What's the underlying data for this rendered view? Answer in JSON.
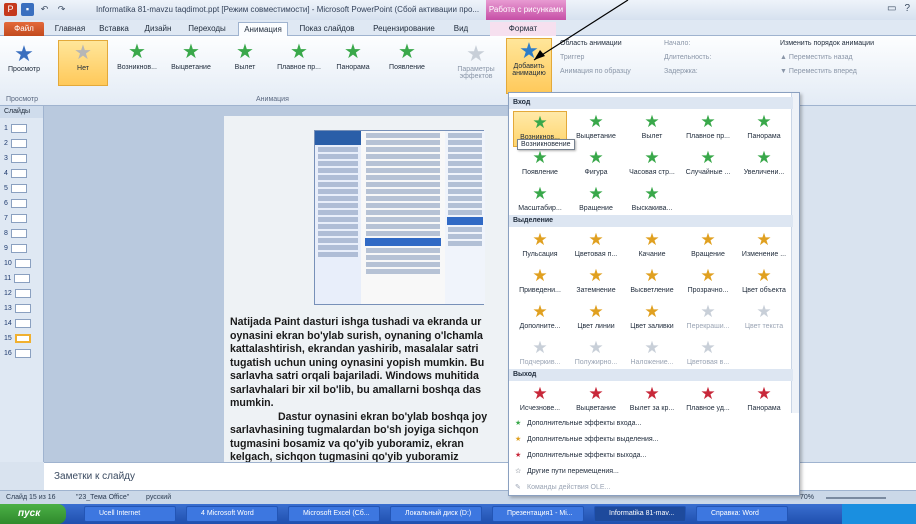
{
  "window": {
    "title": "Informatika 81-mavzu taqdimot.ppt [Режим совместимости] - Microsoft PowerPoint (Сбой активации про...",
    "context_header": "Работа с рисунками"
  },
  "tabs": [
    "Файл",
    "Главная",
    "Вставка",
    "Дизайн",
    "Переходы",
    "Анимация",
    "Показ слайдов",
    "Рецензирование",
    "Вид",
    "Формат"
  ],
  "ribbon": {
    "preview_label": "Просмотр",
    "gallery": [
      "Нет",
      "Возникнов...",
      "Выцветание",
      "Вылет",
      "Плавное пр...",
      "Панорама",
      "Появление"
    ],
    "effect_params": "Параметры эффектов",
    "add_animation": "Добавить анимацию",
    "advanced": [
      "Область анимации",
      "Триггер",
      "Анимация по образцу"
    ],
    "timing": [
      "Начало:",
      "Длительность:",
      "Задержка:"
    ],
    "reorder": [
      "Изменить порядок анимации",
      "▲ Переместить назад",
      "▼ Переместить вперед"
    ],
    "group_labels": [
      "Просмотр",
      "Анимация"
    ]
  },
  "left_panel": {
    "tab_label": "Слайды",
    "slide_numbers": [
      "1",
      "2",
      "3",
      "4",
      "5",
      "6",
      "7",
      "8",
      "9",
      "10",
      "11",
      "12",
      "13",
      "14",
      "15",
      "16"
    ],
    "selected": "15"
  },
  "slide": {
    "paragraph1": [
      "Natijada Paint dasturi ishga tushadi va ekranda ur",
      "oynasini ekran bo'ylab surish, oynaning o'lchamla",
      "kattalashtirish, ekrandan yashirib, masalalar satri",
      "tugatish uchun uning oynasini yopish mumkin. Bu",
      "sarlavha satri orqali bajariladi. Windows muhitida",
      "sarlavhalari bir xil bo'lib, bu amallarni boshqa das",
      "mumkin."
    ],
    "paragraph2": [
      "Dastur oynasini ekran bo'ylab boshqa joy",
      "sarlavhasining tugmalardan bo'sh joyiga sichqon",
      "tugmasini bosamiz va qo'yib yuboramiz, ekran",
      "kelgach, sichqon tugmasini qo'yib yuboramiz"
    ]
  },
  "dropdown": {
    "tooltip": "Возникновение",
    "sections": {
      "entry": "Вход",
      "emphasis": "Выделение",
      "exit": "Выход"
    },
    "entry_items": [
      "Возникнов...",
      "Выцветание",
      "Вылет",
      "Плавное пр...",
      "Панорама",
      "Появление",
      "Фигура",
      "Часовая стр...",
      "Случайные ...",
      "Увеличени...",
      "Масштабир...",
      "Вращение",
      "Выскакива..."
    ],
    "emphasis_items": [
      "Пульсация",
      "Цветовая п...",
      "Качание",
      "Вращение",
      "Изменение ...",
      "Приведени...",
      "Затемнение",
      "Высветление",
      "Прозрачно...",
      "Цвет объекта",
      "Дополните...",
      "Цвет линии",
      "Цвет заливки",
      "Перекраши...",
      "Цвет текста",
      "Подчеркив...",
      "Полужирно...",
      "Наложение...",
      "Цветовая в..."
    ],
    "exit_items": [
      "Исчезнове...",
      "Выцветание",
      "Вылет за кр...",
      "Плавное уд...",
      "Панорама"
    ],
    "links": [
      "Дополнительные эффекты входа...",
      "Дополнительные эффекты выделения...",
      "Дополнительные эффекты выхода...",
      "Другие пути перемещения...",
      "Команды действия OLE..."
    ]
  },
  "notes": {
    "placeholder": "Заметки к слайду"
  },
  "status": {
    "slide_info": "Слайд 15 из 16",
    "theme": "\"23_Тема Office\"",
    "language": "русский",
    "zoom": "70%"
  },
  "taskbar": {
    "start": "пуск",
    "buttons": [
      "Ucell Internet",
      "4 Microsoft Word",
      "Microsoft Excel (Сб...",
      "Локальный диск (D:)",
      "Презентация1 - Mi...",
      "Informatika 81-mav...",
      "Справка: Word"
    ]
  },
  "colors": {
    "accent": "#2a5ea8",
    "file_tab": "#c24a1e",
    "context": "#c64fa6",
    "star_green": "#39a84a",
    "star_gold": "#e0a020"
  }
}
